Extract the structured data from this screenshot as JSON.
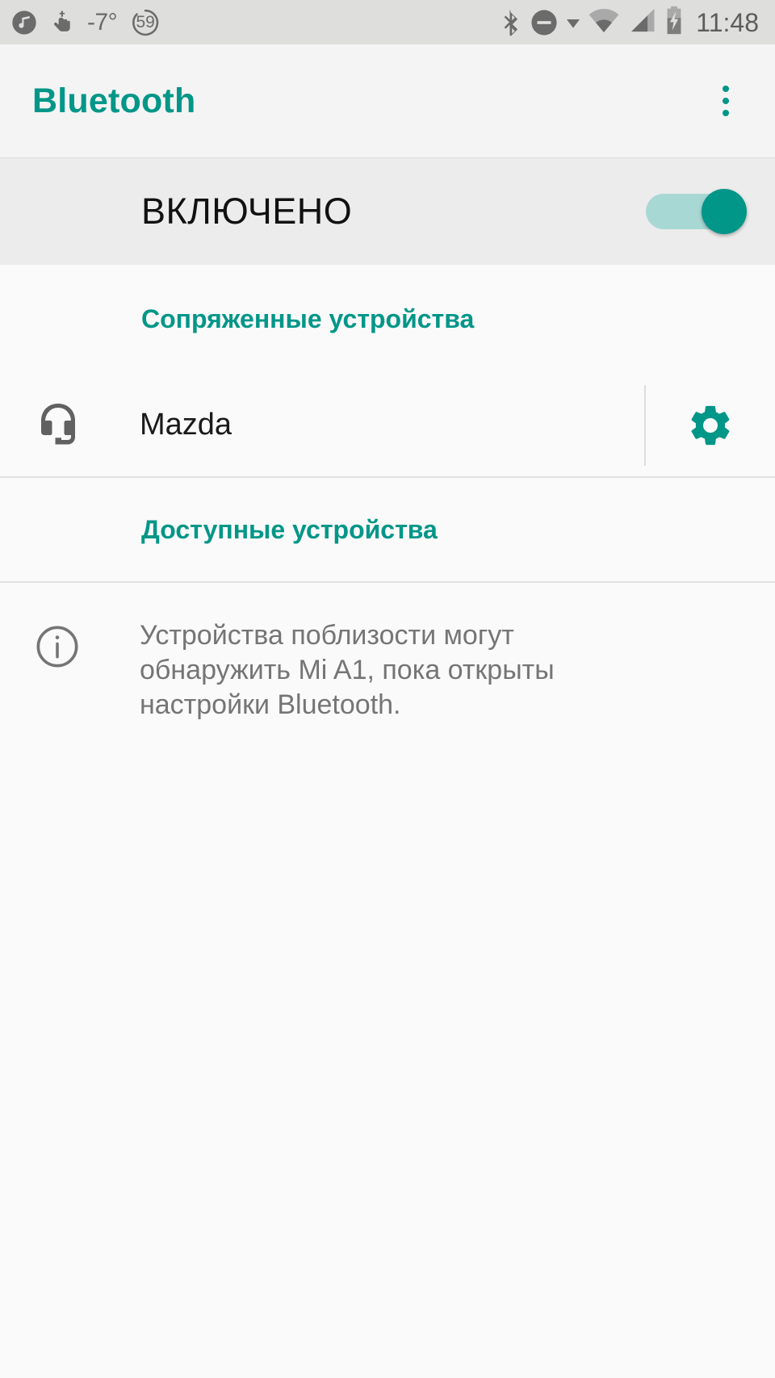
{
  "status_bar": {
    "left_icons": [
      {
        "name": "music-note-icon",
        "label": "music-note"
      },
      {
        "name": "do-not-touch-icon",
        "label": "touch-gesture"
      }
    ],
    "temperature": "-7°",
    "battery_saver_value": "59",
    "right_icons": [
      {
        "name": "bluetooth-icon",
        "label": "bluetooth"
      },
      {
        "name": "do-not-disturb-icon",
        "label": "do-not-disturb"
      },
      {
        "name": "dropdown-caret-icon",
        "label": "caret"
      },
      {
        "name": "wifi-icon",
        "label": "wifi"
      },
      {
        "name": "cellular-signal-icon",
        "label": "signal"
      },
      {
        "name": "battery-charging-icon",
        "label": "battery-charging"
      }
    ],
    "clock": "11:48"
  },
  "app_bar": {
    "title": "Bluetooth",
    "overflow_label": "more-options"
  },
  "master_switch": {
    "label": "ВКЛЮЧЕНО",
    "state": "on"
  },
  "sections": {
    "paired": {
      "header": "Сопряженные устройства",
      "devices": [
        {
          "name": "Mazda",
          "icon": "headset-mic-icon",
          "settings_icon": "gear-icon"
        }
      ]
    },
    "available": {
      "header": "Доступные устройства",
      "info_icon": "info-icon",
      "info_text": "Устройства поблизости могут обнаружить Mi A1, пока открыты настройки Bluetooth."
    }
  },
  "colors": {
    "accent": "#009688",
    "switch_track": "#a8d8d4",
    "status_bar_bg": "#dededd",
    "app_bar_bg": "#f4f4f4",
    "switch_bar_bg": "#ececec",
    "content_bg": "#fafafa",
    "body_text": "#757575"
  }
}
